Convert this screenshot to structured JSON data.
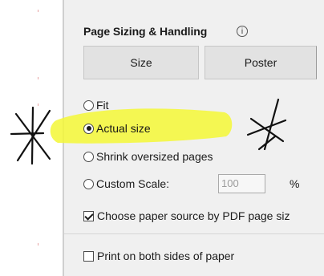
{
  "section": {
    "title": "Page Sizing & Handling",
    "info_glyph": "i"
  },
  "buttons": {
    "size_label": "Size",
    "poster_label": "Poster"
  },
  "options": {
    "fit_label": "Fit",
    "actual_size_label": "Actual size",
    "shrink_label": "Shrink oversized pages",
    "custom_scale_label": "Custom Scale:",
    "selected": "Actual size"
  },
  "custom_scale": {
    "value": "100",
    "unit": "%"
  },
  "checkboxes": {
    "paper_source_label": "Choose paper source by PDF page siz",
    "paper_source_checked": true,
    "both_sides_label": "Print on both sides of paper",
    "both_sides_checked": false
  },
  "annotations": {
    "highlight_color": "#f4f73b",
    "ink_color": "#111111"
  },
  "colors": {
    "panel_bg": "#f0f0f0",
    "button_bg": "#e2e2e2"
  }
}
